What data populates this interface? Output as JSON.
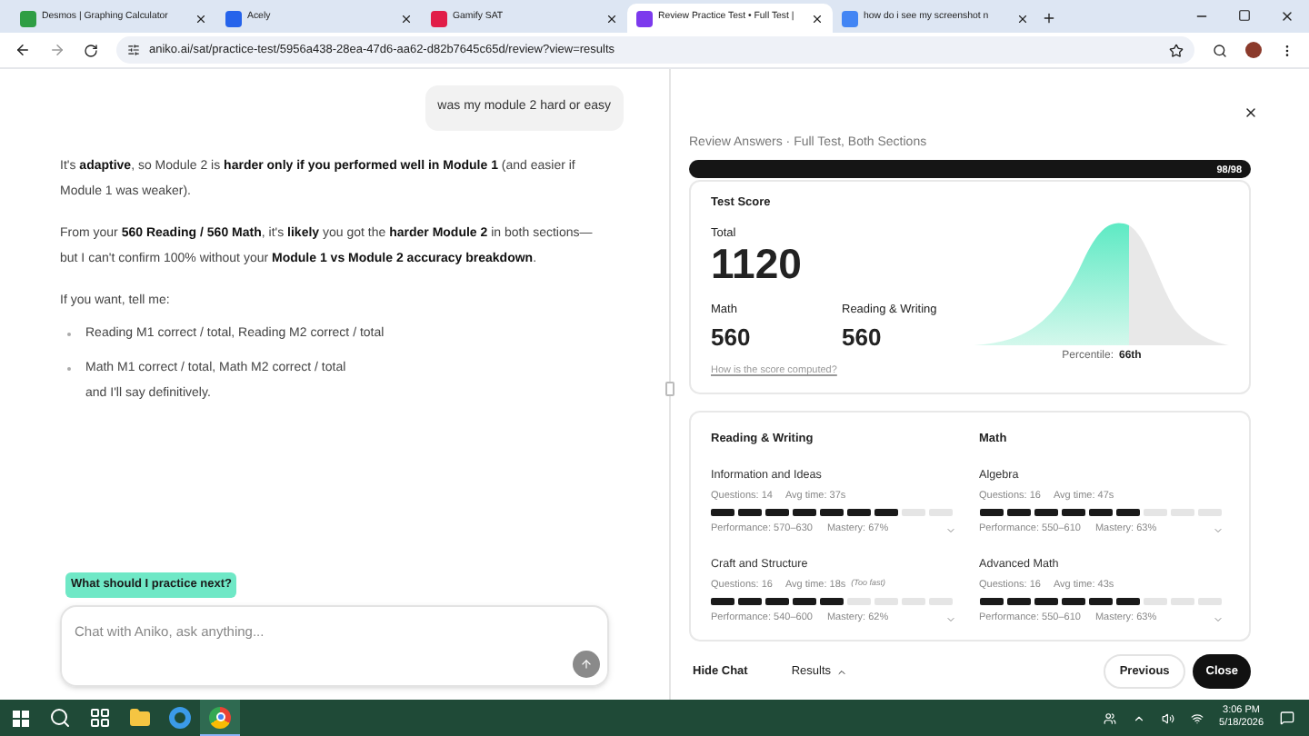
{
  "browser": {
    "tabs": [
      {
        "title": "Desmos | Graphing Calculator",
        "selected": false
      },
      {
        "title": "Acely",
        "selected": false
      },
      {
        "title": "Gamify SAT",
        "selected": false
      },
      {
        "title": "Review Practice Test • Full Test |",
        "selected": true
      },
      {
        "title": "how do i see my screenshot n",
        "selected": false
      }
    ],
    "url": "aniko.ai/sat/practice-test/5956a438-28ea-47d6-aa62-d82b7645c65d/review?view=results"
  },
  "chat": {
    "user_message": "was my module 2 hard or easy",
    "reply": [
      {
        "kind": "paragraph",
        "text": "It's **adaptive**, so Module 2 is **harder only if you performed well in Module 1** (and easier if Module 1 was weaker)."
      },
      {
        "kind": "paragraph",
        "text": "From your **560 Reading / 560 Math**, it's **likely** you got the **harder Module 2** in both sections—but I can't confirm 100% without your **Module 1 vs Module 2 accuracy breakdown**."
      },
      {
        "kind": "paragraph",
        "text": "If you want, tell me:"
      },
      {
        "kind": "bullet",
        "text": "Reading M1 correct / total, Reading M2 correct / total"
      },
      {
        "kind": "bullet",
        "text": "Math M1 correct / total, Math M2 correct / total",
        "after": "and I'll say definitively."
      }
    ],
    "suggestion": "What should I practice next?",
    "input": {
      "placeholder": "Chat with Aniko, ask anything..."
    }
  },
  "review": {
    "heading": "Review Answers · Full Test, Both Sections",
    "progress": {
      "level": 1,
      "reading": "98/98"
    },
    "score": {
      "title": "Test Score",
      "total_label": "Total",
      "total": "1120",
      "sections": [
        {
          "label": "Math",
          "score": "560"
        },
        {
          "label": "Reading & Writing",
          "score": "560"
        }
      ],
      "link": "How is the score computed?",
      "percentile_label": "Percentile:",
      "percentile": "66th"
    },
    "domains": [
      {
        "title": "Reading & Writing",
        "items": [
          {
            "name": "Information and Ideas",
            "questions": "Questions: 14",
            "avg_time": "Avg time: 37s",
            "level": 0.778,
            "performance": "Performance: 570–630",
            "mastery": "Mastery: 67%"
          },
          {
            "name": "Craft and Structure",
            "questions": "Questions: 16",
            "avg_time": "Avg time: 18s",
            "note": "(Too fast)",
            "level": 0.556,
            "performance": "Performance: 540–600",
            "mastery": "Mastery: 62%"
          }
        ]
      },
      {
        "title": "Math",
        "items": [
          {
            "name": "Algebra",
            "questions": "Questions: 16",
            "avg_time": "Avg time: 47s",
            "level": 0.667,
            "performance": "Performance: 550–610",
            "mastery": "Mastery: 63%"
          },
          {
            "name": "Advanced Math",
            "questions": "Questions: 16",
            "avg_time": "Avg time: 43s",
            "level": 0.667,
            "performance": "Performance: 550–610",
            "mastery": "Mastery: 63%"
          }
        ]
      }
    ],
    "footer": {
      "hide_chat": "Hide Chat",
      "results": "Results",
      "previous": "Previous",
      "close": "Close"
    }
  },
  "taskbar": {
    "apps": [
      {
        "selected": false
      },
      {
        "selected": false
      },
      {
        "selected": false
      },
      {
        "selected": false
      },
      {
        "selected": true
      }
    ],
    "time": "3:06 PM",
    "date": "5/18/2026"
  }
}
